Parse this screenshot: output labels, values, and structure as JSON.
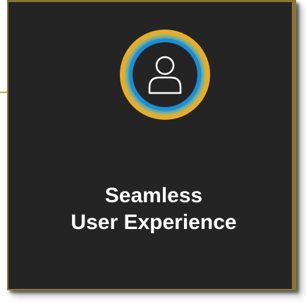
{
  "card": {
    "title_line1": "Seamless",
    "title_line2": "User Experience",
    "icon": "user-icon",
    "colors": {
      "background": "#242424",
      "border": "#8a7533",
      "ring_outer": "#f2b01e",
      "ring_inner": "#1a8fd6",
      "glyph": "#ffffff",
      "title": "#ffffff"
    }
  }
}
